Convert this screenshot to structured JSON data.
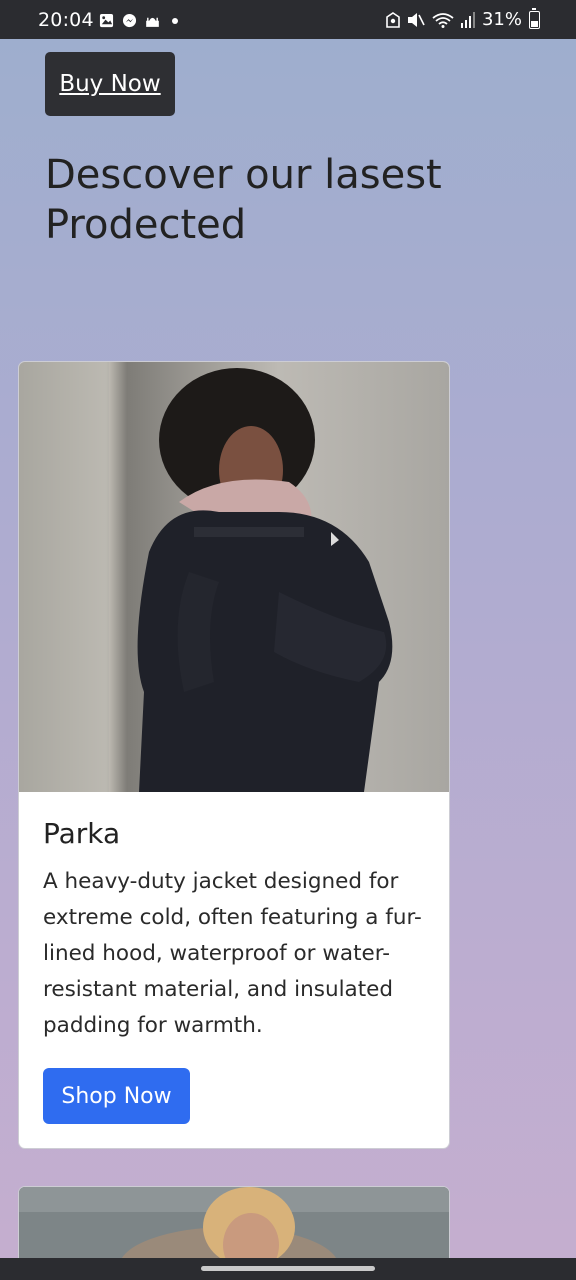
{
  "status_bar": {
    "time": "20:04",
    "left_icons": [
      "gallery-icon",
      "messenger-icon",
      "mosque-icon",
      "dot-icon"
    ],
    "right_icons": [
      "alarm-icon",
      "mute-icon",
      "wifi-icon",
      "signal-icon"
    ],
    "battery_text": "31%"
  },
  "hero": {
    "buy_button_label": "Buy Now",
    "heading": "Descover our lasest Prodected"
  },
  "products": [
    {
      "title": "Parka",
      "description": "A heavy-duty jacket designed for extreme cold, often featuring a fur-lined hood, waterproof or water-resistant material, and insulated padding for warmth.",
      "button_label": "Shop Now"
    }
  ],
  "colors": {
    "dark_button": "#2e2f33",
    "primary_button": "#2f6cf0",
    "background_top": "#9daece",
    "background_bottom": "#c5aecf"
  }
}
